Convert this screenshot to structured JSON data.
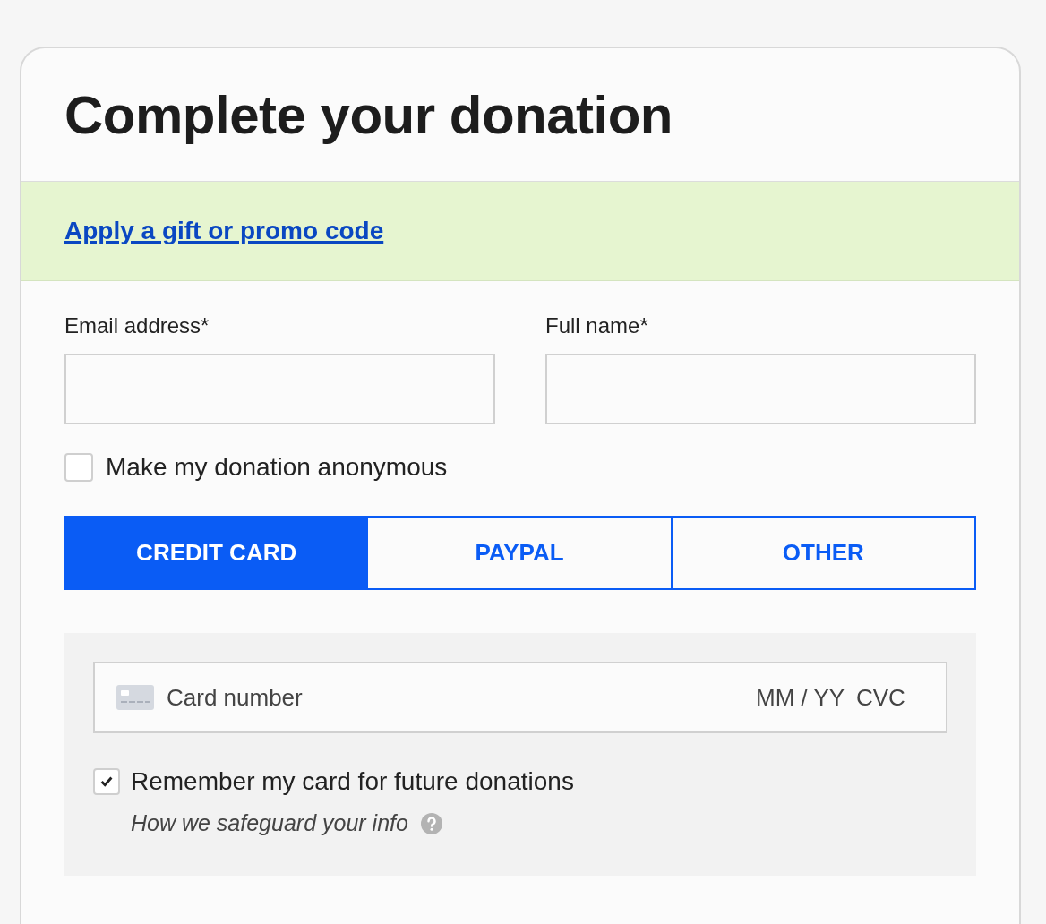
{
  "title": "Complete your donation",
  "promo_link": "Apply a gift or promo code",
  "fields": [
    {
      "label": "Email address*"
    },
    {
      "label": "Full name*"
    }
  ],
  "anonymous": {
    "label": "Make my donation anonymous",
    "checked": false
  },
  "payment_tabs": [
    {
      "label": "CREDIT CARD",
      "selected": true
    },
    {
      "label": "PAYPAL",
      "selected": false
    },
    {
      "label": "OTHER",
      "selected": false
    }
  ],
  "card_input": {
    "card_number_placeholder": "Card number",
    "expiry_placeholder": "MM / YY",
    "cvc_placeholder": "CVC"
  },
  "remember_card": {
    "label": "Remember my card for future donations",
    "checked": true
  },
  "safeguard_link": "How we safeguard your info"
}
